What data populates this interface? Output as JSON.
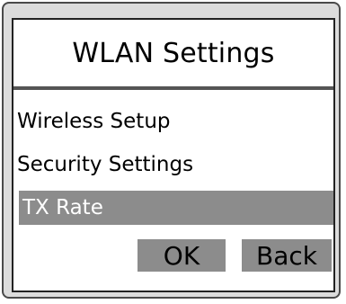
{
  "header": {
    "title": "WLAN Settings"
  },
  "menu": {
    "items": [
      {
        "label": "Wireless Setup",
        "selected": false
      },
      {
        "label": "Security Settings",
        "selected": false
      },
      {
        "label": "TX Rate",
        "selected": true
      }
    ]
  },
  "softkeys": {
    "ok_label": "OK",
    "back_label": "Back"
  },
  "colors": {
    "frame": "#dcdcdc",
    "screen": "#ffffff",
    "highlight": "#8c8c8c",
    "divider": "#555555"
  }
}
